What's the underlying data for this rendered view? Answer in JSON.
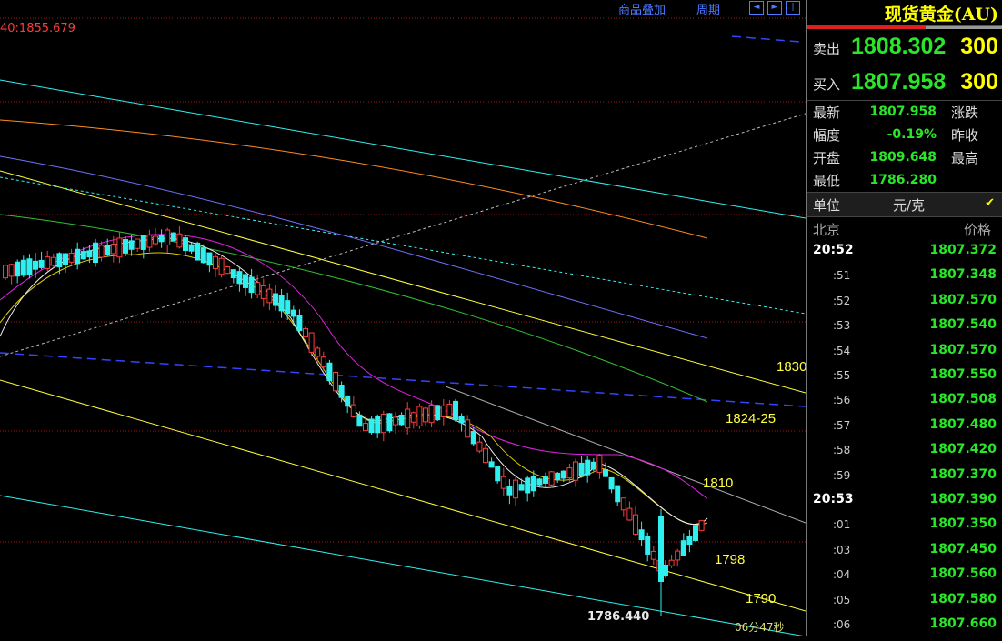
{
  "toolbar": {
    "overlay_link": "商品叠加",
    "period_link": "周期",
    "nav_left": "◄",
    "nav_right": "►",
    "nav_end": "|"
  },
  "chart": {
    "crosshair_readout": "40:1855.679",
    "levels": [
      "1830",
      "1824-25",
      "1810",
      "1798",
      "1790"
    ],
    "low_label": "1786.440",
    "time_label": "06分47秒"
  },
  "panel": {
    "title": "现货黄金(AU)",
    "sell_label": "卖出",
    "sell_price": "1808.302",
    "sell_vol": "300",
    "buy_label": "买入",
    "buy_price": "1807.958",
    "buy_vol": "300",
    "stats": [
      {
        "k": "最新",
        "v": "1807.958",
        "k2": "涨跌"
      },
      {
        "k": "幅度",
        "v": "-0.19%",
        "k2": "昨收"
      },
      {
        "k": "开盘",
        "v": "1809.648",
        "k2": "最高"
      },
      {
        "k": "最低",
        "v": "1786.280",
        "k2": ""
      }
    ],
    "unit_label": "单位",
    "unit_value": "元/克",
    "unit_check": "✔",
    "ticks_header_time": "北京",
    "ticks_header_price": "价格",
    "ticks": [
      {
        "t": "20:52",
        "p": "1807.372"
      },
      {
        "t": ":51",
        "p": "1807.348"
      },
      {
        "t": ":52",
        "p": "1807.570"
      },
      {
        "t": ":53",
        "p": "1807.540"
      },
      {
        "t": ":54",
        "p": "1807.570"
      },
      {
        "t": ":55",
        "p": "1807.550"
      },
      {
        "t": ":56",
        "p": "1807.508"
      },
      {
        "t": ":57",
        "p": "1807.480"
      },
      {
        "t": ":58",
        "p": "1807.420"
      },
      {
        "t": ":59",
        "p": "1807.370"
      },
      {
        "t": "20:53",
        "p": "1807.390"
      },
      {
        "t": ":01",
        "p": "1807.350"
      },
      {
        "t": ":03",
        "p": "1807.450"
      },
      {
        "t": ":04",
        "p": "1807.560"
      },
      {
        "t": ":05",
        "p": "1807.580"
      },
      {
        "t": ":06",
        "p": "1807.660"
      }
    ]
  },
  "colors": {
    "up": "#ff3b3b",
    "down": "#2ff0f0",
    "price_green": "#29e629",
    "accent_yellow": "#ffff00",
    "link_blue": "#4c7bff"
  }
}
